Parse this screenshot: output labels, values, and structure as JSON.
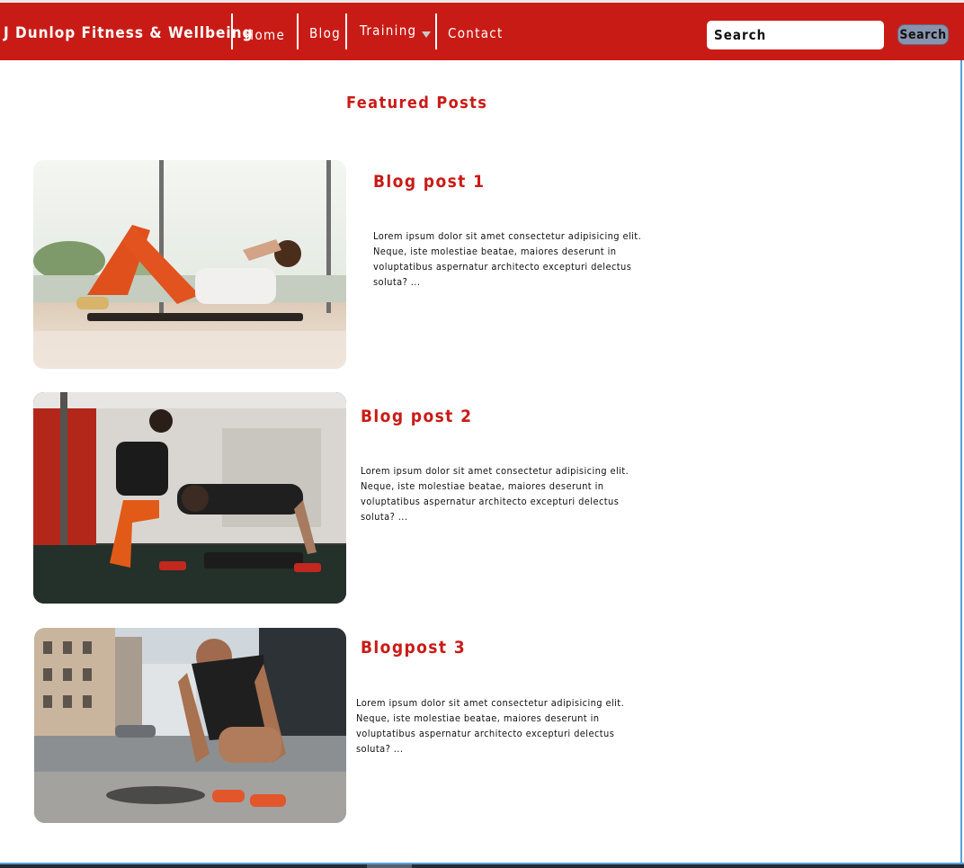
{
  "nav": {
    "brand": "J Dunlop Fitness & Wellbeing",
    "links": [
      "Home",
      "Blog",
      "Training",
      "Contact"
    ],
    "search_placeholder": "Search",
    "search_button": "Search"
  },
  "main": {
    "section_title": "Featured Posts",
    "posts": [
      {
        "title": "Blog post 1",
        "excerpt": "Lorem ipsum dolor sit amet consectetur adipisicing elit. Neque, iste molestiae beatae, maiores deserunt in voluptatibus aspernatur architecto excepturi delectus soluta? ..."
      },
      {
        "title": "Blog post 2",
        "excerpt": "Lorem ipsum dolor sit amet consectetur adipisicing elit. Neque, iste molestiae beatae, maiores deserunt in voluptatibus aspernatur architecto excepturi delectus soluta? ..."
      },
      {
        "title": "Blogpost 3",
        "excerpt": "Lorem ipsum dolor sit amet consectetur adipisicing elit. Neque, iste molestiae beatae, maiores deserunt in voluptatibus aspernatur architecto excepturi delectus soluta? ..."
      }
    ]
  },
  "colors": {
    "brand_red": "#c91b16",
    "window_border": "#5aa0d8",
    "search_button": "#8894ad"
  }
}
